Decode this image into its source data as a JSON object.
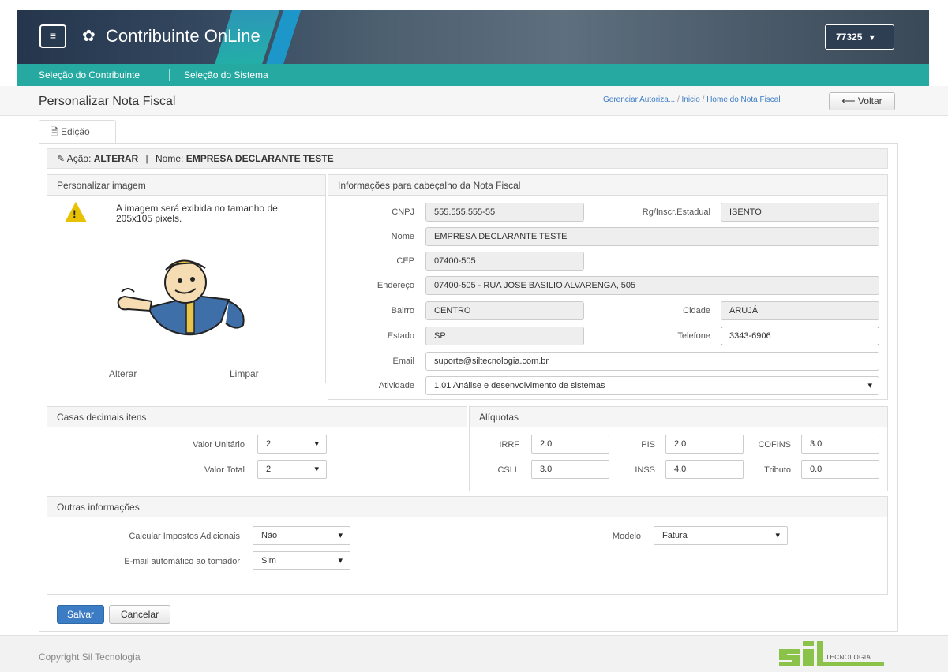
{
  "header": {
    "app_title": "Contribuinte OnLine",
    "menu_icon": "hamburger-icon",
    "gear_icon": "gear-icon",
    "user_code": "77325"
  },
  "nav": {
    "items": [
      {
        "label": "Seleção do Contribuinte"
      },
      {
        "label": "Seleção do Sistema"
      }
    ]
  },
  "page": {
    "title": "Personalizar Nota Fiscal",
    "breadcrumb": [
      "Gerenciar Autoriza...",
      "Inicio",
      "Home do Nota Fiscal"
    ],
    "back_label": "Voltar"
  },
  "tab": {
    "label": "Edição"
  },
  "action": {
    "acao_label": "Ação:",
    "acao_value": "ALTERAR",
    "separator": "|",
    "nome_label": "Nome:",
    "nome_value": "EMPRESA DECLARANTE TESTE"
  },
  "image_panel": {
    "title": "Personalizar imagem",
    "warning": "A imagem será exibida no tamanho de 205x105 pixels.",
    "alterar": "Alterar",
    "limpar": "Limpar"
  },
  "header_info": {
    "title": "Informações para cabeçalho da Nota Fiscal",
    "cnpj_label": "CNPJ",
    "cnpj": "555.555.555-55",
    "rg_label": "Rg/Inscr.Estadual",
    "rg": "ISENTO",
    "nome_label": "Nome",
    "nome": "EMPRESA DECLARANTE TESTE",
    "cep_label": "CEP",
    "cep": "07400-505",
    "endereco_label": "Endereço",
    "endereco": "07400-505 - RUA  JOSE BASILIO ALVARENGA, 505",
    "bairro_label": "Bairro",
    "bairro": "CENTRO",
    "cidade_label": "Cidade",
    "cidade": "ARUJÁ",
    "estado_label": "Estado",
    "estado": "SP",
    "telefone_label": "Telefone",
    "telefone": "3343-6906",
    "email_label": "Email",
    "email": "suporte@siltecnologia.com.br",
    "atividade_label": "Atividade",
    "atividade": "1.01 Análise e desenvolvimento de sistemas"
  },
  "decimais": {
    "title": "Casas decimais itens",
    "valor_unitario_label": "Valor Unitário",
    "valor_unitario": "2",
    "valor_total_label": "Valor Total",
    "valor_total": "2"
  },
  "aliquotas": {
    "title": "Alíquotas",
    "irrf_label": "IRRF",
    "irrf": "2.0",
    "pis_label": "PIS",
    "pis": "2.0",
    "cofins_label": "COFINS",
    "cofins": "3.0",
    "csll_label": "CSLL",
    "csll": "3.0",
    "inss_label": "INSS",
    "inss": "4.0",
    "tributo_label": "Tributo",
    "tributo": "0.0"
  },
  "outras": {
    "title": "Outras informações",
    "calcular_label": "Calcular Impostos Adicionais",
    "calcular": "Não",
    "email_auto_label": "E-mail automático ao tomador",
    "email_auto": "Sim",
    "modelo_label": "Modelo",
    "modelo": "Fatura"
  },
  "buttons": {
    "salvar": "Salvar",
    "cancelar": "Cancelar"
  },
  "footer": {
    "copyright": "Copyright Sil Tecnologia",
    "logo_text": "TECNOLOGIA"
  },
  "colors": {
    "nav_teal": "#25a9a0",
    "primary_blue": "#3b7cc4",
    "logo_green": "#8bc34a"
  }
}
